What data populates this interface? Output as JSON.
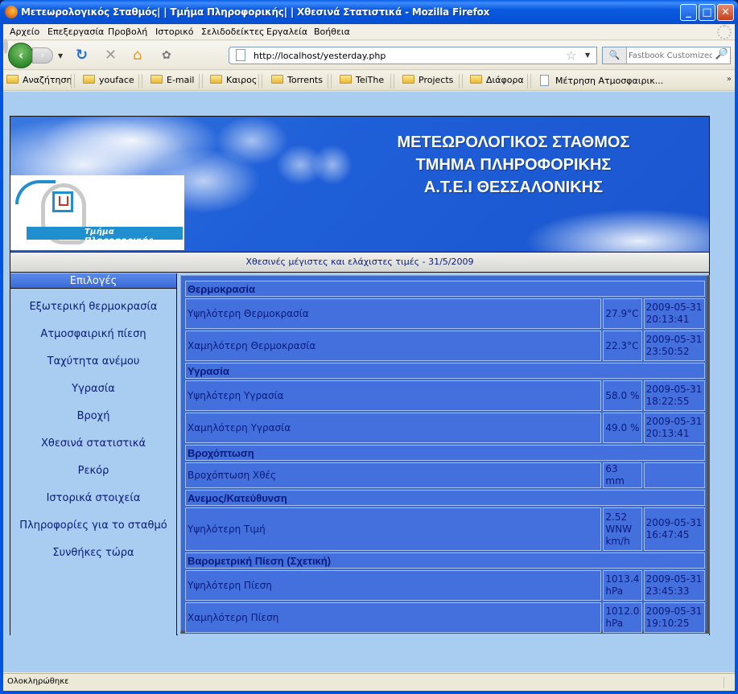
{
  "window": {
    "title": "Μετεωρολογικός Σταθμός| | Τμήμα Πληροφορικής| | Χθεσινά Στατιστικά - Mozilla Firefox",
    "controls": {
      "minimize": "_",
      "maximize": "□",
      "close": "✕"
    }
  },
  "menu": [
    "Αρχείο",
    "Επεξεργασία",
    "Προβολή",
    "Ιστορικό",
    "Σελιδοδείκτες",
    "Εργαλεία",
    "Βοήθεια"
  ],
  "navbar": {
    "back": "‹",
    "forward": "›",
    "reload": "↻",
    "stop": "✕",
    "home": "⌂",
    "plugin": "✿",
    "url": "http://localhost/yesterday.php",
    "star": "☆",
    "search_engine": "🔍",
    "search_placeholder": "Fastbook Customized",
    "search_go": "🔎"
  },
  "bookmarks": [
    {
      "label": "Αναζήτηση",
      "icon": "folder"
    },
    {
      "label": "youface",
      "icon": "folder"
    },
    {
      "label": "E-mail",
      "icon": "folder"
    },
    {
      "label": "Καιρος",
      "icon": "folder"
    },
    {
      "label": "Torrents",
      "icon": "folder"
    },
    {
      "label": "TeiThe",
      "icon": "folder"
    },
    {
      "label": "Projects",
      "icon": "folder"
    },
    {
      "label": "Διάφορα",
      "icon": "folder"
    },
    {
      "label": "Μέτρηση Ατμοσφαιρικ...",
      "icon": "page"
    }
  ],
  "bookmarks_more": "»",
  "banner": {
    "lines": [
      "ΜΕΤΕΩΡΟΛΟΓΙΚΟΣ ΣΤΑΘΜΟΣ",
      "ΤΜΗΜΑ ΠΛΗΡΟΦΟΡΙΚΗΣ",
      "Α.Τ.Ε.Ι ΘΕΣΣΑΛΟΝΙΚΗΣ"
    ],
    "logo_text": "Τμήμα Πληροφορικής"
  },
  "subtitle": "Χθεσινές μέγιστες και ελάχιστες τιμές - 31/5/2009",
  "sidebar": {
    "heading": "Επιλογές",
    "items": [
      "Εξωτερική θερμοκρασία",
      "Ατμοσφαιρική πίεση",
      "Ταχύτητα ανέμου",
      "Υγρασία",
      "Βροχή",
      "Χθεσινά στατιστικά",
      "Ρεκόρ",
      "Ιστορικά στοιχεία",
      "Πληροφορίες για το σταθμό",
      "Συνθήκες τώρα"
    ]
  },
  "stats": {
    "temperature": {
      "heading": "Θερμοκρασία",
      "rows": [
        {
          "label": "Υψηλότερη Θερμοκρασία",
          "value": "27.9°C",
          "time": "2009-05-31 20:13:41"
        },
        {
          "label": "Χαμηλότερη Θερμοκρασία",
          "value": "22.3°C",
          "time": "2009-05-31 23:50:52"
        }
      ]
    },
    "humidity": {
      "heading": "Υγρασία",
      "rows": [
        {
          "label": "Υψηλότερη Υγρασία",
          "value": "58.0 %",
          "time": "2009-05-31 18:22:55"
        },
        {
          "label": "Χαμηλότερη Υγρασία",
          "value": "49.0 %",
          "time": "2009-05-31 20:13:41"
        }
      ]
    },
    "rain": {
      "heading": "Βροχόπτωση",
      "rows": [
        {
          "label": "Βροχόπτωση Χθές",
          "value": "63 mm",
          "time": ""
        }
      ]
    },
    "wind": {
      "heading": "Ανεμος/Κατεύθυνση",
      "rows": [
        {
          "label": "Υψηλότερη Τιμή",
          "value": "2.52 WNW km/h",
          "time": "2009-05-31 16:47:45"
        }
      ]
    },
    "pressure": {
      "heading": "Βαρομετρική Πίεση (Σχετική)",
      "rows": [
        {
          "label": "Υψηλότερη Πίεση",
          "value": "1013.4 hPa",
          "time": "2009-05-31 23:45:33"
        },
        {
          "label": "Χαμηλότερη Πίεση",
          "value": "1012.0 hPa",
          "time": "2009-05-31 19:10:25"
        }
      ]
    }
  },
  "status": "Ολοκληρώθηκε"
}
